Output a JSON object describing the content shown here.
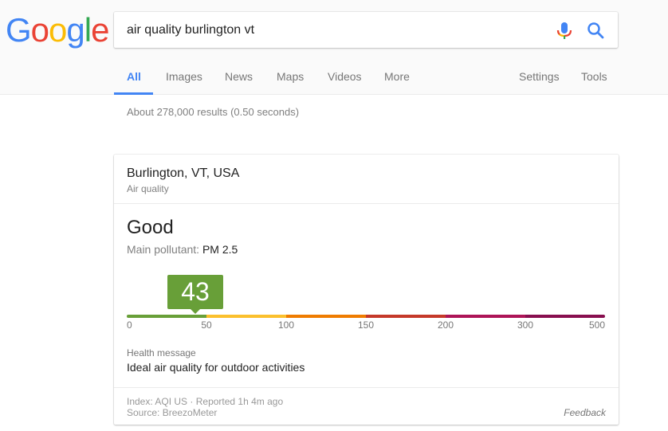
{
  "logo": {
    "letters": [
      "G",
      "o",
      "o",
      "g",
      "l",
      "e"
    ],
    "colors": [
      "#4285f4",
      "#ea4335",
      "#fbbc05",
      "#4285f4",
      "#34a853",
      "#ea4335"
    ]
  },
  "search": {
    "value": "air quality burlington vt",
    "mic_icon": "microphone-icon",
    "search_icon": "magnifier-icon"
  },
  "tabs": [
    {
      "label": "All",
      "active": true
    },
    {
      "label": "Images"
    },
    {
      "label": "News"
    },
    {
      "label": "Maps"
    },
    {
      "label": "Videos"
    },
    {
      "label": "More"
    }
  ],
  "tools": [
    {
      "label": "Settings"
    },
    {
      "label": "Tools"
    }
  ],
  "stats": "About 278,000 results (0.50 seconds)",
  "card": {
    "location": "Burlington, VT, USA",
    "subtitle": "Air quality",
    "status": "Good",
    "pollutant_label": "Main pollutant:",
    "pollutant_value": "PM 2.5",
    "aqi": {
      "value": 43,
      "display": "43",
      "accent": "#689f38"
    },
    "scale": {
      "ticks": [
        "0",
        "50",
        "100",
        "150",
        "200",
        "300",
        "500"
      ],
      "segment_colors": [
        "#689f38",
        "#fbc02d",
        "#ef7c00",
        "#c53929",
        "#ad1457",
        "#880e4f"
      ]
    },
    "health_label": "Health message",
    "health_message": "Ideal air quality for outdoor activities",
    "footer": {
      "index": "Index: AQI US",
      "separator": "·",
      "reported": "Reported 1h 4m ago",
      "source": "Source: BreezoMeter",
      "feedback": "Feedback"
    }
  }
}
